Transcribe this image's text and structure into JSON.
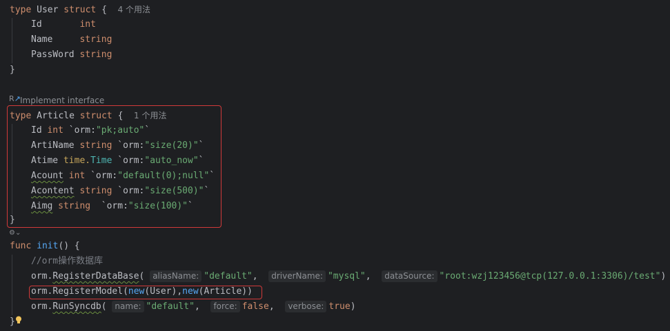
{
  "user_struct": {
    "kw_type": "type",
    "name": "User",
    "kw_struct": "struct",
    "brace": "{",
    "usages": "4 个用法",
    "fields": [
      {
        "name": "Id",
        "type": "int"
      },
      {
        "name": "Name",
        "type": "string"
      },
      {
        "name": "PassWord",
        "type": "string"
      }
    ],
    "close": "}"
  },
  "implement_hint": "Implement interface",
  "article_struct": {
    "kw_type": "type",
    "name": "Article",
    "kw_struct": "struct",
    "brace": "{",
    "usages": "1 个用法",
    "fields": [
      {
        "name": "Id",
        "type": "int",
        "tag_open": " `orm:",
        "tag_val": "\"pk;auto\"",
        "tag_close": "`"
      },
      {
        "name": "ArtiName",
        "type": "string",
        "tag_open": " `orm:",
        "tag_val": "\"size(20)\"",
        "tag_close": "`"
      },
      {
        "name": "Atime",
        "type_pkg": "time.",
        "type": "Time",
        "tag_open": " `orm:",
        "tag_val": "\"auto_now\"",
        "tag_close": "`"
      },
      {
        "name": "Acount",
        "type": "int",
        "tag_open": " `orm:",
        "tag_val": "\"default(0);null\"",
        "tag_close": "`"
      },
      {
        "name": "Acontent",
        "type": "string",
        "tag_open": " `orm:",
        "tag_val": "\"size(500)\"",
        "tag_close": "`"
      },
      {
        "name": "Aimg",
        "type": "string",
        "tag_open": "  `orm:",
        "tag_val": "\"size(100)\"",
        "tag_close": "`"
      }
    ],
    "close": "}"
  },
  "init_func": {
    "kw_func": "func",
    "name": "init",
    "sig_rest": "() {",
    "comment": "//orm操作数据库",
    "register_db": {
      "pkg": "orm.",
      "method": "RegisterDataBase",
      "open": "(",
      "hint1": "aliasName:",
      "arg1": "\"default\"",
      "comma1": ", ",
      "hint2": "driverName:",
      "arg2": "\"mysql\"",
      "comma2": ", ",
      "hint3": "dataSource:",
      "arg3": "\"root:wzj123456@tcp(127.0.0.1:3306)/test\"",
      "close": ")"
    },
    "register_model": {
      "pkg": "orm.",
      "method": "RegisterModel",
      "open": "(",
      "new1": "new",
      "arg1": "(User)",
      "comma": ",",
      "new2": "new",
      "arg2": "(Article)",
      "close": ")"
    },
    "run_sync": {
      "pkg": "orm.",
      "method": "RunSyncdb",
      "open": "(",
      "hint1": "name:",
      "arg1": "\"default\"",
      "comma1": ", ",
      "hint2": "force:",
      "arg2": "false",
      "comma2": ", ",
      "hint3": "verbose:",
      "arg3": "true",
      "close": ")"
    },
    "close": "}"
  },
  "colors": {
    "background": "#1e1f22",
    "keyword": "#cf8e6d",
    "string": "#6aab73",
    "function": "#56a8f5",
    "highlight_box": "#d23a3a"
  }
}
